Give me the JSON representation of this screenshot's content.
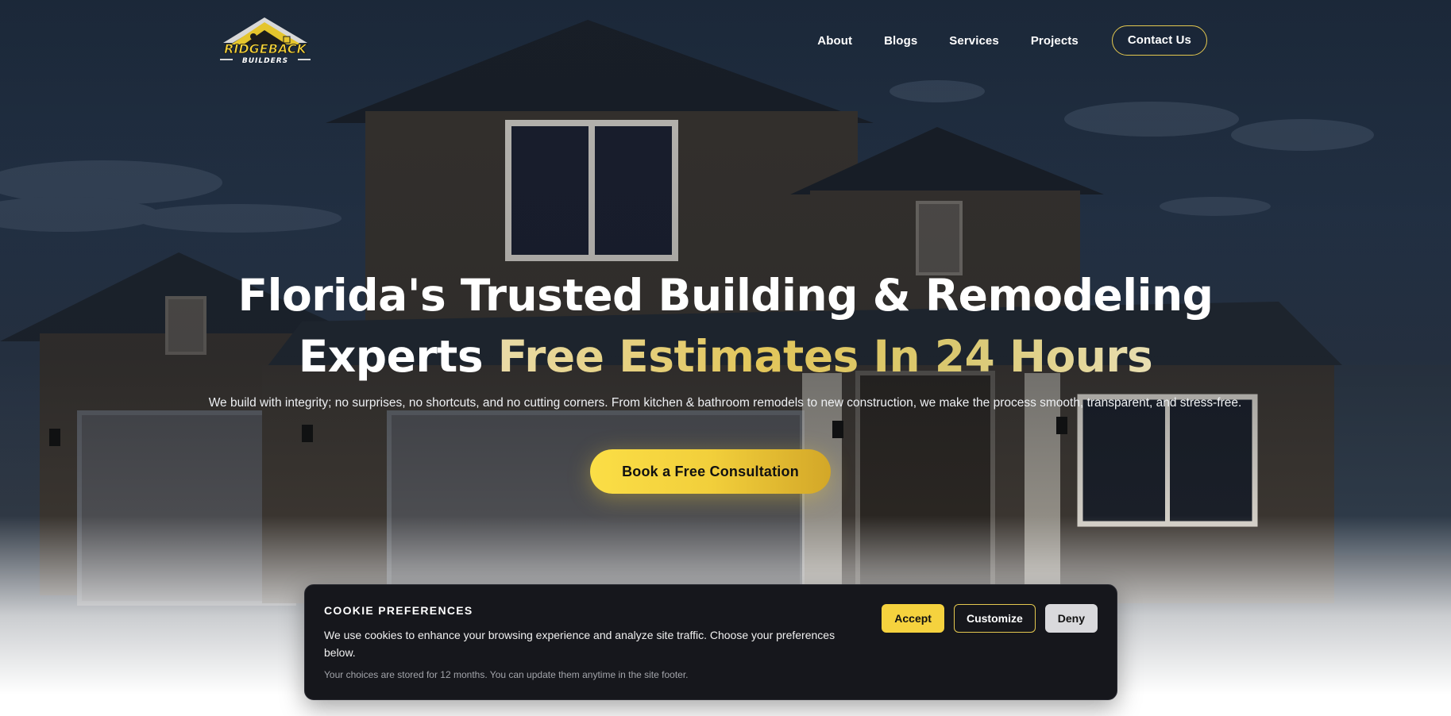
{
  "header": {
    "logo_text": "RIDGEBACK BUILDERS",
    "nav": [
      "About",
      "Blogs",
      "Services",
      "Projects"
    ],
    "contact_label": "Contact Us"
  },
  "hero": {
    "headline_white_1": "Florida's Trusted Building & Remodeling",
    "headline_white_2": "Experts ",
    "headline_gold": "Free Estimates In 24 Hours",
    "subtext": "We build with integrity; no surprises, no shortcuts, and no cutting corners. From kitchen & bathroom remodels to new construction, we make the process smooth, transparent, and stress-free.",
    "cta_label": "Book a Free Consultation"
  },
  "cookie": {
    "title": "COOKIE PREFERENCES",
    "description": "We use cookies to enhance your browsing experience and analyze site traffic. Choose your preferences below.",
    "note": "Your choices are stored for 12 months. You can update them anytime in the site footer.",
    "accept_label": "Accept",
    "customize_label": "Customize",
    "deny_label": "Deny"
  },
  "colors": {
    "accent": "#f5d23e",
    "gold_text": "#e2c65a",
    "panel": "#16171c"
  }
}
